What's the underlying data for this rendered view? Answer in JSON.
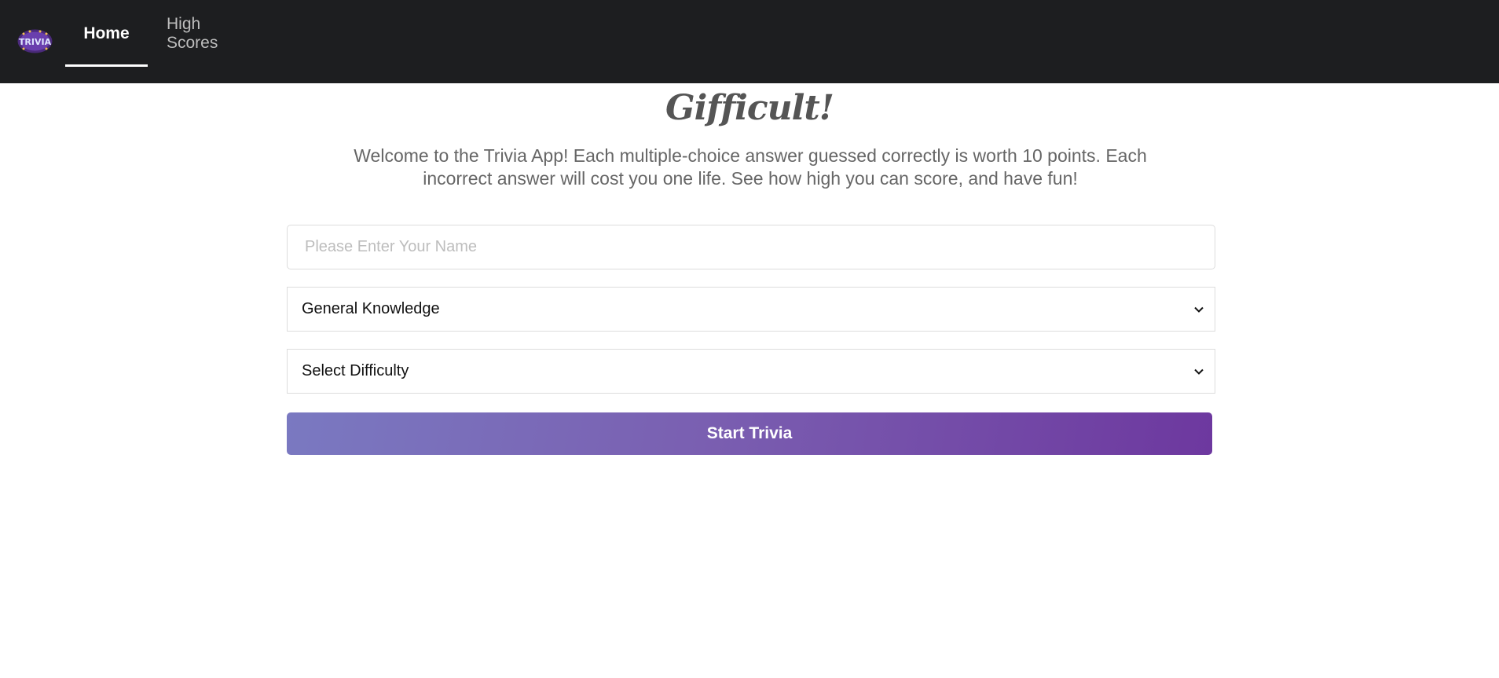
{
  "nav": {
    "logo_text": "TRIVIA",
    "home_label": "Home",
    "high_scores_label": "High Scores"
  },
  "main": {
    "title": "Gifficult!",
    "welcome_text": "Welcome to the Trivia App! Each multiple-choice answer guessed correctly is worth 10 points. Each incorrect answer will cost you one life. See how high you can score, and have fun!",
    "name_placeholder": "Please Enter Your Name",
    "category_selected": "General Knowledge",
    "difficulty_selected": "Select Difficulty",
    "start_button_label": "Start Trivia"
  },
  "colors": {
    "navbar_bg": "#1d1e20",
    "button_gradient_start": "#7a79c1",
    "button_gradient_end": "#6d389f"
  }
}
